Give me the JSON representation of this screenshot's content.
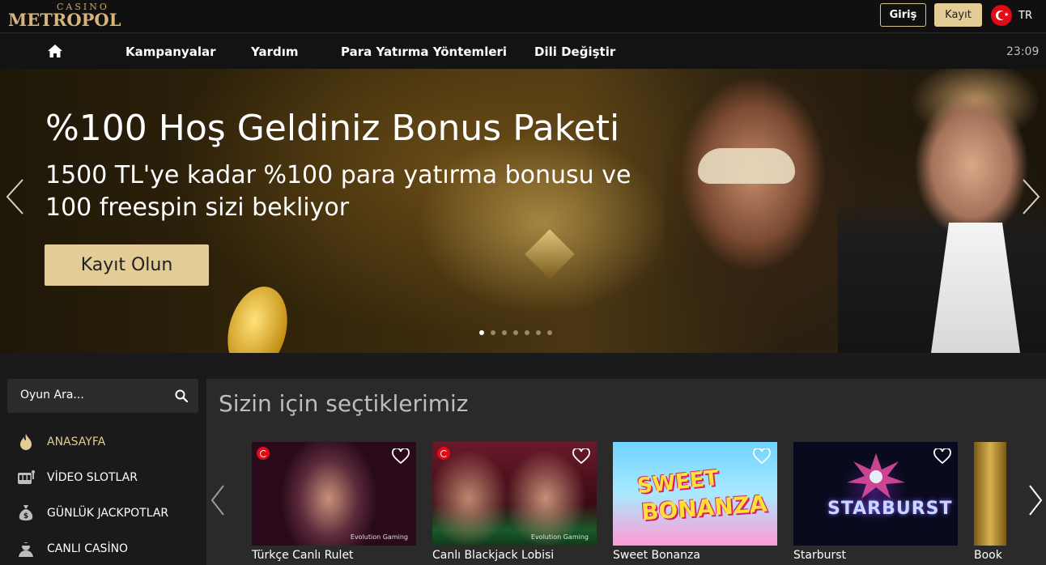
{
  "header": {
    "logo_small": "CASINO",
    "logo_big": "METROPOL",
    "login_label": "Giriş",
    "register_label": "Kayıt",
    "language": "TR"
  },
  "nav": {
    "items": [
      "Kampanyalar",
      "Yardım",
      "Para Yatırma Yöntemleri",
      "Dili Değiştir"
    ],
    "time": "23:09"
  },
  "hero": {
    "title": "%100 Hoş Geldiniz Bonus Paketi",
    "subtitle": "1500 TL'ye kadar %100 para yatırma bonusu ve 100 freespin sizi bekliyor",
    "cta_label": "Kayıt Olun",
    "slide_count": 7,
    "active_slide": 1
  },
  "sidebar": {
    "search_placeholder": "Oyun Ara...",
    "items": [
      {
        "label": "ANASAYFA",
        "icon": "flame-icon",
        "active": true
      },
      {
        "label": "VİDEO SLOTLAR",
        "icon": "slot-machine-icon",
        "active": false
      },
      {
        "label": "GÜNLÜK JACKPOTLAR",
        "icon": "money-bag-icon",
        "active": false
      },
      {
        "label": "CANLI CASİNO",
        "icon": "dealer-icon",
        "active": false
      }
    ]
  },
  "games": {
    "section_title": "Sizin için seçtiklerimiz",
    "items": [
      {
        "title": "Türkçe Canlı Rulet",
        "provider": "Evolution Gaming"
      },
      {
        "title": "Canlı Blackjack Lobisi",
        "provider": "Evolution Gaming"
      },
      {
        "title": "Sweet Bonanza",
        "logo_top": "SWEET",
        "logo_bottom": "BONANZA"
      },
      {
        "title": "Starburst",
        "logo": "STARBURST"
      },
      {
        "title": "Book o"
      }
    ]
  },
  "colors": {
    "accent": "#e3cc95",
    "topbar": "#101010",
    "panel": "#2a2a2a"
  }
}
